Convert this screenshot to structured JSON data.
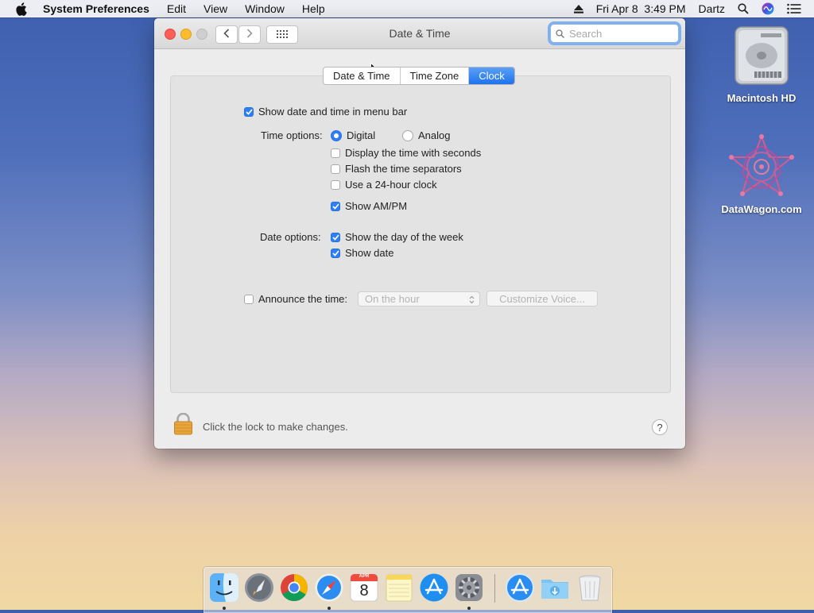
{
  "menubar": {
    "app_name": "System Preferences",
    "items": [
      "Edit",
      "View",
      "Window",
      "Help"
    ],
    "datetime": "Fri Apr 8  3:49 PM",
    "user": "Dartz"
  },
  "desktop": {
    "icons": [
      {
        "label": "Macintosh HD",
        "icon": "hard-drive-icon"
      },
      {
        "label": "DataWagon.com",
        "icon": "datawagon-logo-icon"
      }
    ]
  },
  "window": {
    "title": "Date & Time",
    "search_placeholder": "Search",
    "tabs": [
      {
        "label": "Date & Time",
        "active": false
      },
      {
        "label": "Time Zone",
        "active": false
      },
      {
        "label": "Clock",
        "active": true
      }
    ],
    "clock": {
      "show_in_menubar": {
        "label": "Show date and time in menu bar",
        "checked": true
      },
      "time_options_label": "Time options:",
      "digital": {
        "label": "Digital",
        "selected": true
      },
      "analog": {
        "label": "Analog",
        "selected": false
      },
      "seconds": {
        "label": "Display the time with seconds",
        "checked": false
      },
      "flash": {
        "label": "Flash the time separators",
        "checked": false
      },
      "h24": {
        "label": "Use a 24-hour clock",
        "checked": false
      },
      "ampm": {
        "label": "Show AM/PM",
        "checked": true
      },
      "date_options_label": "Date options:",
      "day_of_week": {
        "label": "Show the day of the week",
        "checked": true
      },
      "show_date": {
        "label": "Show date",
        "checked": true
      },
      "announce": {
        "label": "Announce the time:",
        "checked": false
      },
      "announce_interval": "On the hour",
      "customize_voice": "Customize Voice..."
    },
    "lock_text": "Click the lock to make changes.",
    "help": "?"
  },
  "dock": {
    "apps": [
      "Finder",
      "Launchpad",
      "Google Chrome",
      "Safari",
      "Calendar",
      "Notes",
      "App Store",
      "System Preferences",
      "Applications",
      "Downloads",
      "Trash"
    ],
    "calendar_month": "APR",
    "calendar_day": "8"
  },
  "colors": {
    "accent": "#2f7ff2",
    "close": "#fc5f57",
    "minimize": "#fdbc2e"
  }
}
